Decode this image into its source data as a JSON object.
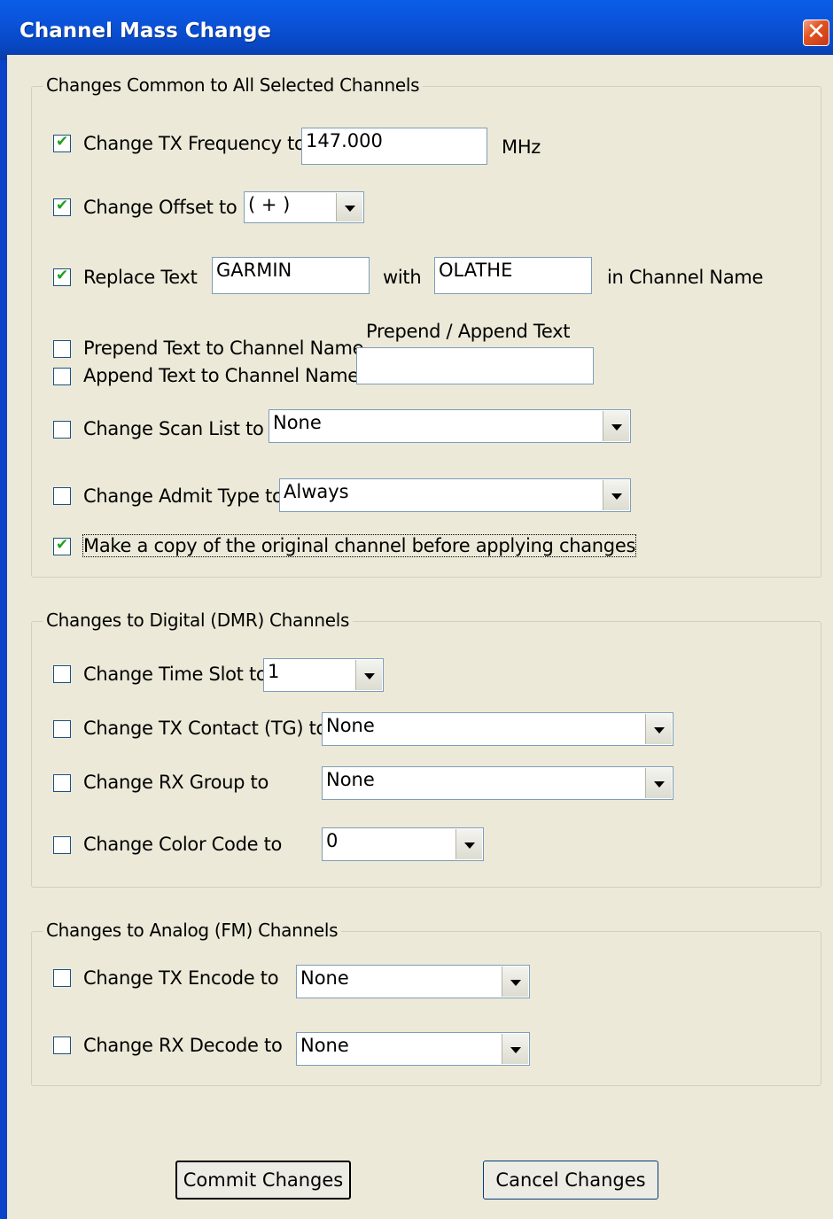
{
  "window": {
    "title": "Channel Mass Change"
  },
  "common": {
    "legend": "Changes Common to All Selected Channels",
    "tx_frequency": {
      "label": "Change TX Frequency to",
      "checked": true,
      "value": "147.000",
      "unit": "MHz"
    },
    "offset": {
      "label": "Change Offset to",
      "checked": true,
      "value": "( + )"
    },
    "replace_text": {
      "label": "Replace Text",
      "checked": true,
      "find_value": "GARMIN",
      "with_label": "with",
      "replace_value": "OLATHE",
      "suffix": "in Channel Name"
    },
    "prepend": {
      "label": "Prepend Text to Channel Name",
      "checked": false
    },
    "append": {
      "label": "Append Text to Channel Name",
      "checked": false
    },
    "prepend_append_text": {
      "label": "Prepend / Append Text",
      "value": ""
    },
    "scan_list": {
      "label": "Change Scan List to",
      "checked": false,
      "value": "None"
    },
    "admit_type": {
      "label": "Change Admit Type to",
      "checked": false,
      "value": "Always"
    },
    "make_copy": {
      "label": "Make a copy of the original channel before applying changes",
      "checked": true
    }
  },
  "digital": {
    "legend": "Changes to Digital (DMR) Channels",
    "time_slot": {
      "label": "Change Time Slot to",
      "checked": false,
      "value": "1"
    },
    "tx_contact": {
      "label": "Change TX Contact (TG) to",
      "checked": false,
      "value": "None"
    },
    "rx_group": {
      "label": "Change RX Group to",
      "checked": false,
      "value": "None"
    },
    "color_code": {
      "label": "Change Color Code to",
      "checked": false,
      "value": "0"
    }
  },
  "analog": {
    "legend": "Changes to Analog (FM) Channels",
    "tx_encode": {
      "label": "Change TX Encode to",
      "checked": false,
      "value": "None"
    },
    "rx_decode": {
      "label": "Change RX Decode to",
      "checked": false,
      "value": "None"
    }
  },
  "buttons": {
    "commit": "Commit Changes",
    "cancel": "Cancel Changes"
  },
  "icons": {
    "close": "close-icon",
    "check": "checkmark-icon",
    "dropdown": "chevron-down-icon"
  },
  "colors": {
    "titlebar": "#0a5de8",
    "dialog_bg": "#ece9d8",
    "close_button": "#e2541f",
    "check": "#21a121"
  }
}
